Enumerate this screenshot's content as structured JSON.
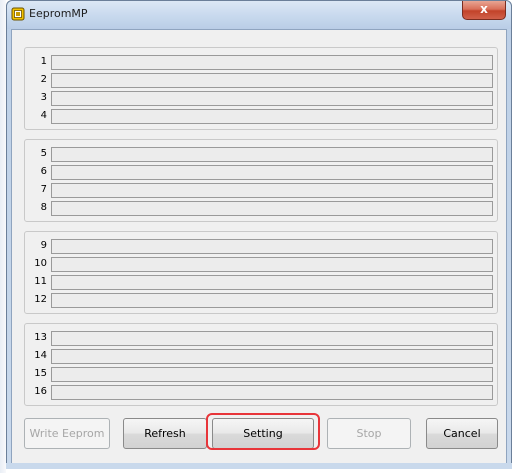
{
  "window": {
    "title": "EepromMP",
    "close_label": "x"
  },
  "groups": [
    {
      "slots": [
        "1",
        "2",
        "3",
        "4"
      ]
    },
    {
      "slots": [
        "5",
        "6",
        "7",
        "8"
      ]
    },
    {
      "slots": [
        "9",
        "10",
        "11",
        "12"
      ]
    },
    {
      "slots": [
        "13",
        "14",
        "15",
        "16"
      ]
    }
  ],
  "buttons": {
    "write_eeprom": "Write Eeprom",
    "refresh": "Refresh",
    "setting": "Setting",
    "stop": "Stop",
    "cancel": "Cancel"
  },
  "highlight_color": "#e8353a"
}
